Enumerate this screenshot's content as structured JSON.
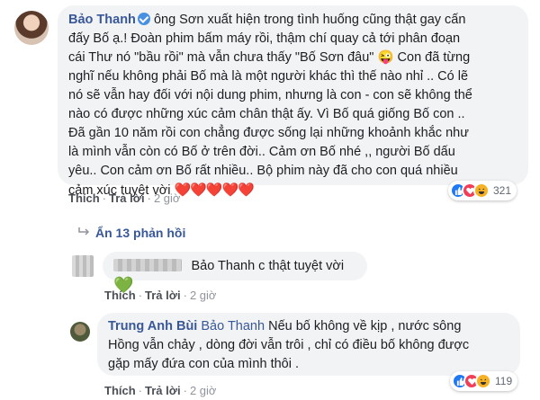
{
  "top_comment": {
    "author": "Bảo Thanh",
    "lines": [
      "ông Sơn xuất hiện trong tình huống cũng thật gay cấn",
      "đấy Bố ạ.! Đoàn phim bấm máy rồi, thậm chí quay cả tới phân đoạn",
      "cái Thư nó \"bầu rồi\" mà vẫn chưa thấy \"Bố Sơn đâu\" 😜 Con đã từng",
      "nghĩ nếu không phải Bố mà là một người khác thì thế nào nhỉ .. Có lẽ",
      "nó sẽ vẫn hay đối với nội dung phim, nhưng là con - con sẽ không thể",
      "nào có được những xúc cảm chân thật ấy. Vì Bố quá giống Bố con ..",
      "Đã gần 10 năm rồi con chẳng được sống lại những khoảnh khắc như",
      "là mình vẫn còn có Bố ở trên đời.. Cảm ơn Bố nhé ,, người Bố dấu",
      "yêu.. Con cảm ơn Bố rất nhiều.. Bộ phim này đã cho con quá nhiều",
      "cảm xúc tuyệt vời"
    ],
    "hearts": "❤️❤️❤️❤️❤️",
    "actions": {
      "like": "Thích",
      "reply": "Trả lời",
      "time": "2 giờ"
    },
    "reaction_count": "321"
  },
  "hidden_replies": "Ẩn 13 phản hồi",
  "reply1": {
    "mention": "Bảo Thanh",
    "text": "c thật tuyệt vời",
    "emoji": "💚",
    "actions": {
      "like": "Thích",
      "reply": "Trả lời",
      "time": "2 giờ"
    }
  },
  "reply2": {
    "author": "Trung Anh Bùi",
    "mention": "Bảo Thanh",
    "line1": "Nếu bố không về kịp , nước sông",
    "line2": "Hồng vẫn chảy , dòng đời vẫn trôi , chỉ có điều bố không được",
    "line3": "gặp mấy đứa con của mình thôi .",
    "actions": {
      "like": "Thích",
      "reply": "Trả lời",
      "time": "2 giờ"
    },
    "reaction_count": "119"
  },
  "colors": {
    "link": "#385898",
    "bubble": "#f2f3f5",
    "like": "#2078f4",
    "love": "#f33e58",
    "haha": "#f7b125"
  }
}
